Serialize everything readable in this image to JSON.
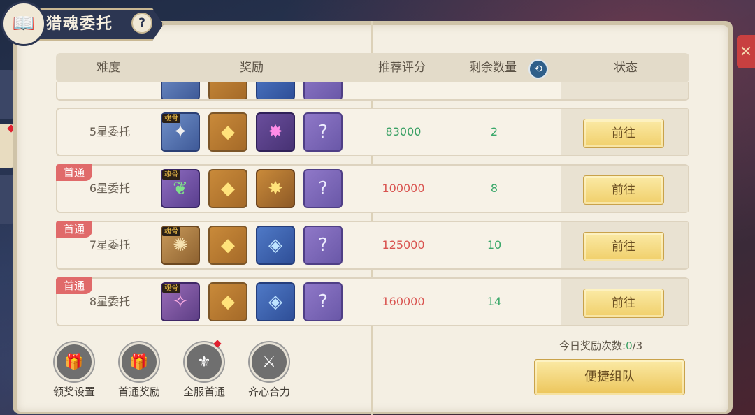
{
  "title": "猎魂委托",
  "help_icon_text": "?",
  "header": {
    "difficulty": "难度",
    "reward": "奖励",
    "score": "推荐评分",
    "remaining": "剩余数量",
    "status": "状态"
  },
  "rows": [
    {
      "difficulty": "5星委托",
      "score": "83000",
      "remaining": "2",
      "first_clear": "",
      "action": "前往"
    },
    {
      "difficulty": "6星委托",
      "score": "100000",
      "remaining": "8",
      "first_clear": "首通",
      "action": "前往"
    },
    {
      "difficulty": "7星委托",
      "score": "125000",
      "remaining": "10",
      "first_clear": "首通",
      "action": "前往"
    },
    {
      "difficulty": "8星委托",
      "score": "160000",
      "remaining": "14",
      "first_clear": "首通",
      "action": "前往"
    }
  ],
  "bone_tag": "魂骨",
  "functions": [
    {
      "label": "领奖设置",
      "icon": "gift-settings-icon"
    },
    {
      "label": "首通奖励",
      "icon": "gift-box-icon"
    },
    {
      "label": "全服首通",
      "icon": "crest-icon"
    },
    {
      "label": "齐心合力",
      "icon": "swords-icon"
    }
  ],
  "daily": {
    "label": "今日奖励次数:",
    "used": "0",
    "sep": "/",
    "max": "3"
  },
  "quick_team": "便捷组队",
  "colors": {
    "accent_green": "#39a064",
    "accent_red": "#d9534f",
    "banner": "#2c3652",
    "button_gold": "#f0cf6a"
  }
}
